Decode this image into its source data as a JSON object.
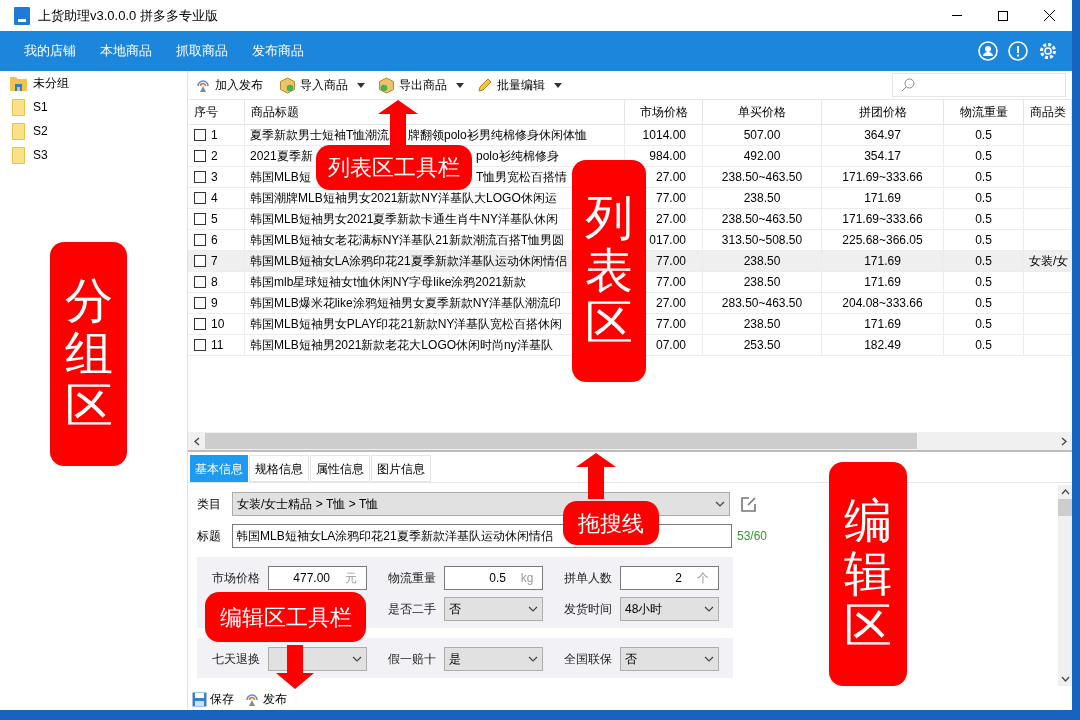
{
  "window": {
    "title": "上货助理v3.0.0.0 拼多多专业版"
  },
  "menu": [
    "我的店铺",
    "本地商品",
    "抓取商品",
    "发布商品"
  ],
  "sidebar": {
    "items": [
      {
        "label": "未分组",
        "kind": "ungrouped"
      },
      {
        "label": "S1",
        "kind": "folder"
      },
      {
        "label": "S2",
        "kind": "folder"
      },
      {
        "label": "S3",
        "kind": "folder"
      }
    ]
  },
  "toolbar": [
    {
      "label": "加入发布",
      "kind": "publish",
      "dropdown": false
    },
    {
      "label": "导入商品",
      "kind": "import",
      "dropdown": true
    },
    {
      "label": "导出商品",
      "kind": "export",
      "dropdown": true
    },
    {
      "label": "批量编辑",
      "kind": "edit",
      "dropdown": true
    }
  ],
  "table": {
    "columns": [
      "序号",
      "商品标题",
      "市场价格",
      "单买价格",
      "拼团价格",
      "物流重量",
      "商品类"
    ],
    "rows": [
      {
        "checked": false,
        "selected": false,
        "cells": [
          "1",
          [
            "夏季新款男士短袖T恤潮流",
            "牌翻领polo衫男纯棉修身休闲体恤"
          ],
          "1014.00",
          "507.00",
          "364.97",
          "0.5"
        ]
      },
      {
        "checked": false,
        "selected": false,
        "cells": [
          "2",
          [
            "2021夏季新",
            "polo衫纯棉修身"
          ],
          "984.00",
          "492.00",
          "354.17",
          "0.5"
        ]
      },
      {
        "checked": false,
        "selected": false,
        "cells": [
          "3",
          [
            "韩国MLB短",
            "T恤男宽松百搭情"
          ],
          "27.00",
          "238.50~463.50",
          "171.69~333.66",
          "0.5"
        ]
      },
      {
        "checked": false,
        "selected": false,
        "cells": [
          "4",
          "韩国潮牌MLB短袖男女2021新款NY洋基队大LOGO休闲运",
          "77.00",
          "238.50",
          "171.69",
          "0.5"
        ]
      },
      {
        "checked": false,
        "selected": false,
        "cells": [
          "5",
          "韩国MLB短袖男女2021夏季新款卡通生肖牛NY洋基队休闲",
          "27.00",
          "238.50~463.50",
          "171.69~333.66",
          "0.5"
        ]
      },
      {
        "checked": false,
        "selected": false,
        "cells": [
          "6",
          "韩国MLB短袖女老花满标NY洋基队21新款潮流百搭T恤男圆",
          "017.00",
          "313.50~508.50",
          "225.68~366.05",
          "0.5"
        ]
      },
      {
        "checked": false,
        "selected": true,
        "cells": [
          "7",
          "韩国MLB短袖女LA涂鸦印花21夏季新款洋基队运动休闲情侣",
          "77.00",
          "238.50",
          "171.69",
          "0.5",
          "女装/女"
        ]
      },
      {
        "checked": false,
        "selected": false,
        "cells": [
          "8",
          "韩国mlb星球短袖女t恤休闲NY字母like涂鸦2021新款",
          "77.00",
          "238.50",
          "171.69",
          "0.5"
        ]
      },
      {
        "checked": false,
        "selected": false,
        "cells": [
          "9",
          "韩国MLB爆米花like涂鸦短袖男女夏季新款NY洋基队潮流印",
          "27.00",
          "283.50~463.50",
          "204.08~333.66",
          "0.5"
        ]
      },
      {
        "checked": false,
        "selected": false,
        "cells": [
          "10",
          "韩国MLB短袖男女PLAY印花21新款NY洋基队宽松百搭休闲",
          "77.00",
          "238.50",
          "171.69",
          "0.5"
        ]
      },
      {
        "checked": false,
        "selected": false,
        "cells": [
          "11",
          "韩国MLB短袖男2021新款老花大LOGO休闲时尚ny洋基队",
          "07.00",
          "253.50",
          "182.49",
          "0.5"
        ]
      }
    ]
  },
  "editor": {
    "tabs": [
      {
        "label": "基本信息",
        "selected": true
      },
      {
        "label": "规格信息",
        "selected": false
      },
      {
        "label": "属性信息",
        "selected": false
      },
      {
        "label": "图片信息",
        "selected": false
      }
    ],
    "category": {
      "label": "类目",
      "value": "女装/女士精品 > T恤 > T恤"
    },
    "title": {
      "label": "标题",
      "value": "韩国MLB短袖女LA涂鸦印花21夏季新款洋基队运动休闲情侣",
      "counter": "53/60"
    },
    "groups": [
      {
        "fields": [
          {
            "kind": "input",
            "label": "市场价格",
            "value": "477.00",
            "unit": "元"
          },
          {
            "kind": "input",
            "label": "物流重量",
            "value": "0.5",
            "unit": "kg"
          },
          {
            "kind": "input",
            "label": "拼单人数",
            "value": "2",
            "unit": "个"
          },
          {
            "kind": "covered"
          },
          {
            "kind": "select",
            "label": "是否二手",
            "value": "否"
          },
          {
            "kind": "select",
            "label": "发货时间",
            "value": "48小时"
          }
        ]
      },
      {
        "fields": [
          {
            "kind": "select",
            "label": "七天退换"
          },
          {
            "kind": "select",
            "label": "假一赔十",
            "value": "是"
          },
          {
            "kind": "select",
            "label": "全国联保",
            "value": "否"
          }
        ]
      }
    ],
    "actions": [
      {
        "label": "保存",
        "kind": "save"
      },
      {
        "label": "发布",
        "kind": "publish"
      }
    ]
  },
  "annotations": [
    {
      "text": "列表区工具栏",
      "kind": "uparrow"
    },
    {
      "text": "列表区",
      "kind": "vertical"
    },
    {
      "text": "分组区",
      "kind": "vertical"
    },
    {
      "text": "拖搜线",
      "kind": "uparrow"
    },
    {
      "text": "编辑区工具栏",
      "kind": "downarrow"
    },
    {
      "text": "编辑区",
      "kind": "vertical"
    }
  ]
}
